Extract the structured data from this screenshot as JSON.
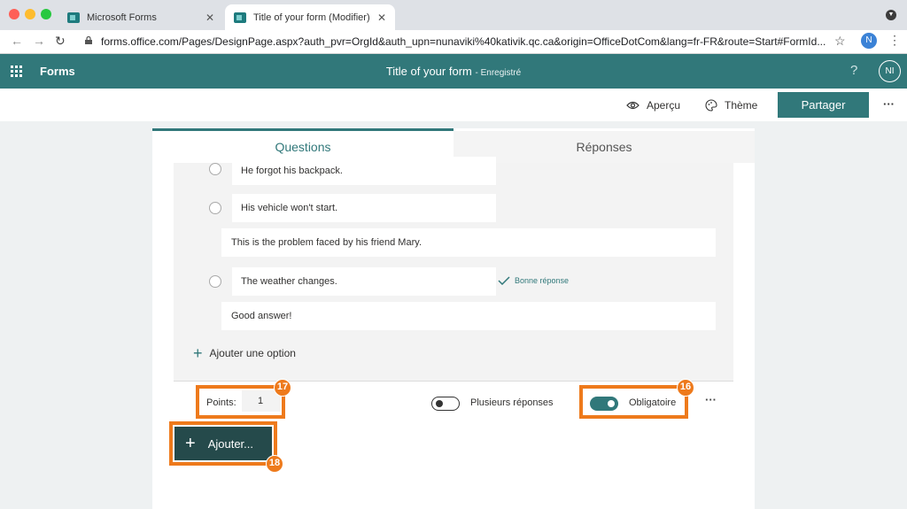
{
  "browser": {
    "tabs": [
      {
        "title": "Microsoft Forms"
      },
      {
        "title": "Title of your form (Modifier) Mi"
      }
    ],
    "url": "forms.office.com/Pages/DesignPage.aspx?auth_pvr=OrgId&auth_upn=nunaviki%40kativik.qc.ca&origin=OfficeDotCom&lang=fr-FR&route=Start#FormId...",
    "profile_initial": "N"
  },
  "header": {
    "app_name": "Forms",
    "form_title": "Title of your form",
    "save_status": "- Enregistré",
    "help": "?",
    "user_initials": "NI"
  },
  "toolbar": {
    "preview": "Aperçu",
    "theme": "Thème",
    "share": "Partager",
    "more": "···"
  },
  "tabs": {
    "questions": "Questions",
    "responses": "Réponses"
  },
  "question": {
    "options": [
      {
        "text": "He forgot his backpack."
      },
      {
        "text": "His vehicle won't start."
      },
      {
        "text": "The weather changes."
      }
    ],
    "feedbacks": [
      "This is the problem faced by his friend Mary.",
      "Good answer!"
    ],
    "correct_answer_label": "Bonne réponse",
    "add_option": "Ajouter une option",
    "points_label": "Points:",
    "points_value": "1",
    "multiple_answers": "Plusieurs réponses",
    "multiple_answers_on": false,
    "required": "Obligatoire",
    "required_on": true,
    "more": "···"
  },
  "add_button": "Ajouter...",
  "annotations": {
    "points": "17",
    "required": "16",
    "add": "18"
  },
  "colors": {
    "brand": "#31787a",
    "callout": "#ee7a1c",
    "add_button": "#254a4b"
  }
}
